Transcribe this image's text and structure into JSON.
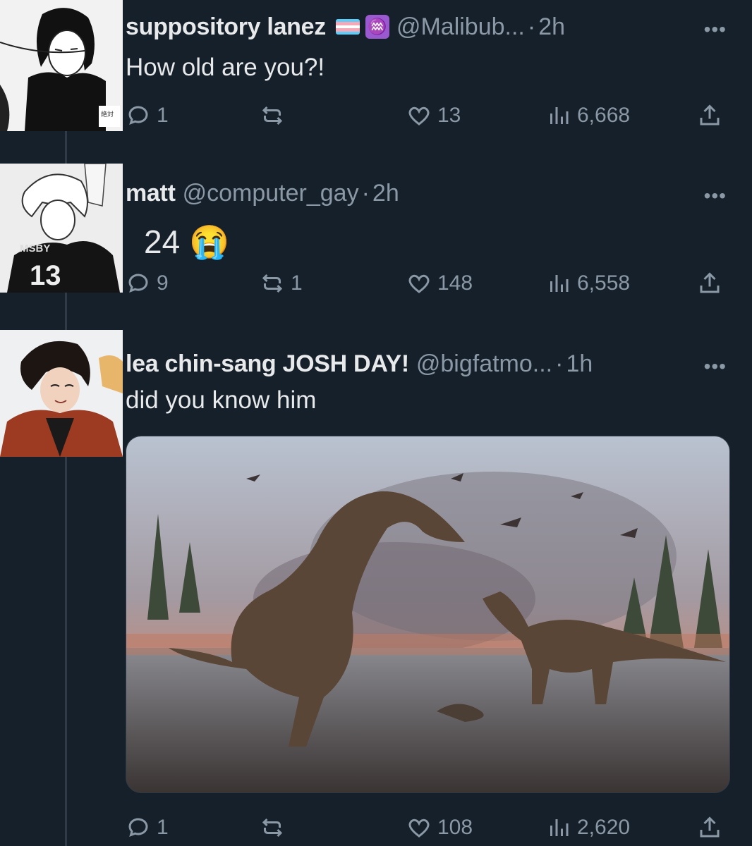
{
  "tweets": [
    {
      "name": "suppository lanez",
      "handle": "@Malibub...",
      "sep": "·",
      "time": "2h",
      "more": "•••",
      "text": "How old are you?!",
      "replies": "1",
      "reposts": "",
      "likes": "13",
      "views": "6,668",
      "badges": [
        "transgender-flag-icon",
        "aquarius-icon"
      ],
      "zodiac_glyph": "♒"
    },
    {
      "name": "matt",
      "handle": "@computer_gay",
      "sep": "·",
      "time": "2h",
      "more": "•••",
      "text": "24 😭",
      "replies": "9",
      "reposts": "1",
      "likes": "148",
      "views": "6,558"
    },
    {
      "name": "lea chin-sang JOSH DAY!",
      "handle": "@bigfatmo...",
      "sep": "·",
      "time": "1h",
      "more": "•••",
      "text": "did you know him",
      "replies": "1",
      "reposts": "",
      "likes": "108",
      "views": "2,620"
    }
  ],
  "colors": {
    "background": "#15202b",
    "text": "#e7e9ea",
    "muted": "#8b98a5",
    "thread_line": "#2f3a46"
  }
}
